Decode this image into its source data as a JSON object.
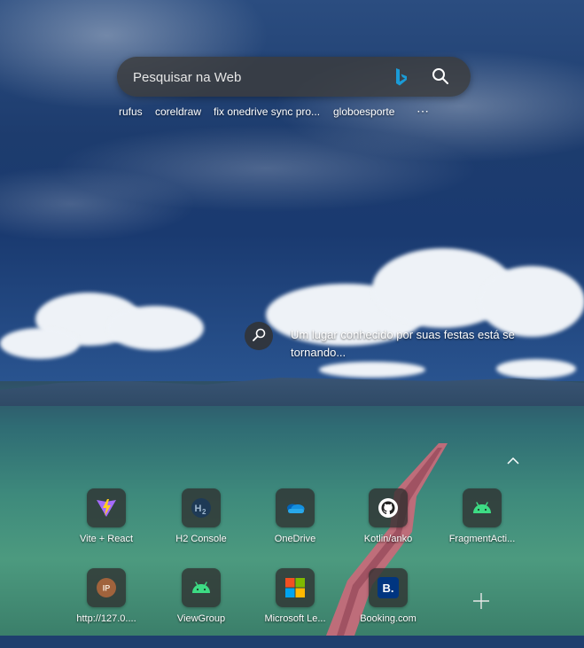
{
  "search": {
    "placeholder": "Pesquisar na Web",
    "quick_links": [
      "rufus",
      "coreldraw",
      "fix onedrive sync pro...",
      "globoesporte"
    ],
    "more_label": "⋯"
  },
  "info": {
    "text": "Um lugar conhecido por suas festas está se tornando..."
  },
  "tiles": [
    {
      "label": "Vite + React",
      "icon": "vite-icon"
    },
    {
      "label": "H2 Console",
      "icon": "h2-icon"
    },
    {
      "label": "OneDrive",
      "icon": "onedrive-icon"
    },
    {
      "label": "Kotlin/anko",
      "icon": "github-icon"
    },
    {
      "label": "FragmentActi...",
      "icon": "android-icon"
    },
    {
      "label": "http://127.0....",
      "icon": "ip-icon",
      "icon_text": "IP"
    },
    {
      "label": "ViewGroup",
      "icon": "android-icon"
    },
    {
      "label": "Microsoft Le...",
      "icon": "microsoft-icon"
    },
    {
      "label": "Booking.com",
      "icon": "booking-icon",
      "icon_text": "B."
    }
  ],
  "colors": {
    "bing": "#1a9bd7",
    "android": "#3ddc84",
    "onedrive": "#0a6ed1",
    "booking": "#003580",
    "ip": "#a0633c"
  }
}
